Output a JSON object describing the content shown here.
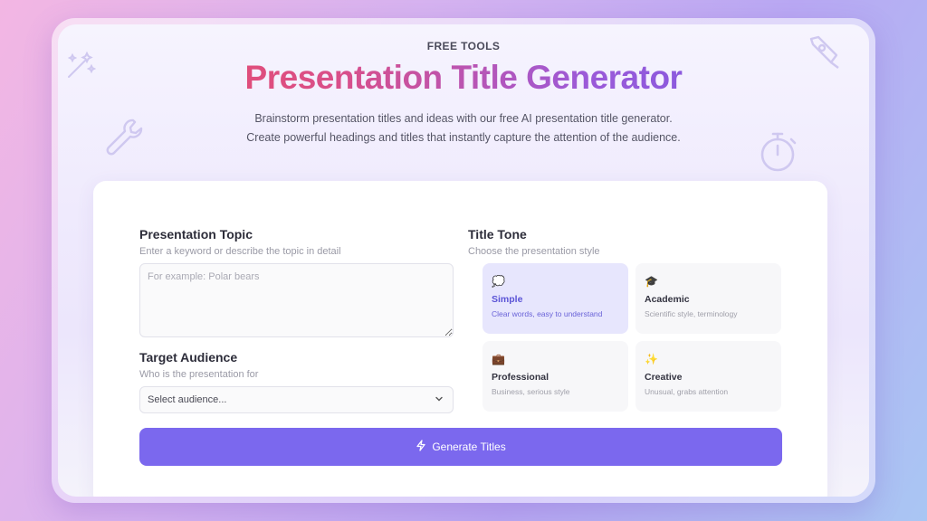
{
  "header": {
    "eyebrow": "FREE TOOLS",
    "title": "Presentation Title Generator",
    "subtitle_line1": "Brainstorm presentation titles and ideas with our free AI presentation title generator.",
    "subtitle_line2": "Create powerful headings and titles that instantly capture the attention of the audience."
  },
  "form": {
    "topic": {
      "label": "Presentation Topic",
      "hint": "Enter a keyword or describe the topic in detail",
      "placeholder": "For example: Polar bears",
      "value": ""
    },
    "audience": {
      "label": "Target Audience",
      "hint": "Who is the presentation for",
      "selected": "Select audience..."
    },
    "tone": {
      "label": "Title Tone",
      "hint": "Choose the presentation style",
      "options": [
        {
          "name": "Simple",
          "desc": "Clear words, easy to understand",
          "emoji": "💭",
          "selected": true
        },
        {
          "name": "Academic",
          "desc": "Scientific style, terminology",
          "emoji": "🎓",
          "selected": false
        },
        {
          "name": "Professional",
          "desc": "Business, serious style",
          "emoji": "💼",
          "selected": false
        },
        {
          "name": "Creative",
          "desc": "Unusual, grabs attention",
          "emoji": "✨",
          "selected": false
        }
      ]
    },
    "generate_label": "Generate Titles"
  },
  "icons": {
    "magic_wand": "magic-wand-icon",
    "wrench": "wrench-icon",
    "pen_nib": "pen-nib-icon",
    "stopwatch": "stopwatch-icon",
    "chevron": "chevron-down-icon",
    "bolt": "lightning-icon"
  },
  "colors": {
    "accent": "#7b68ee",
    "title_gradient_start": "#ec4d5f",
    "title_gradient_end": "#6d5be8",
    "selected_tone_bg": "#e7e6fd"
  }
}
